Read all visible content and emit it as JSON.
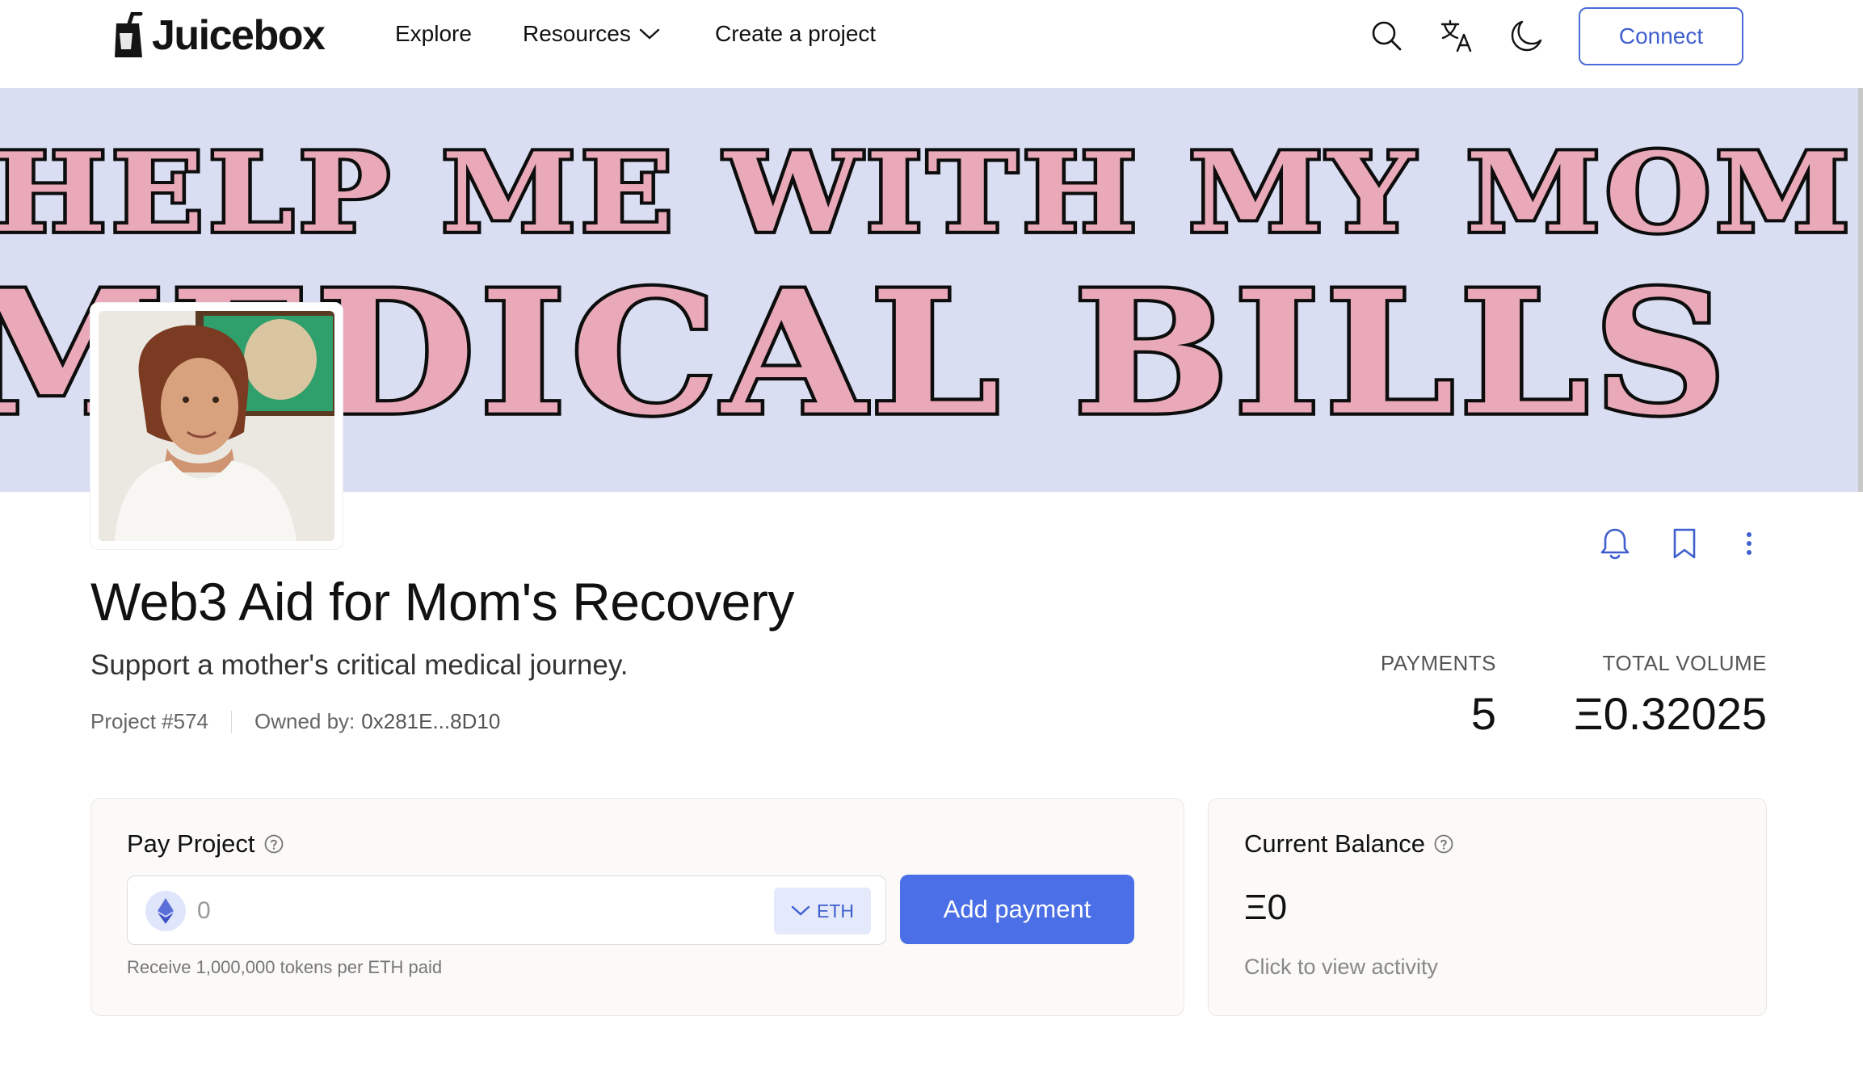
{
  "app": {
    "logo_text": "Juicebox"
  },
  "nav": {
    "explore": "Explore",
    "resources": "Resources",
    "create": "Create a project",
    "connect": "Connect",
    "icons": [
      "search-icon",
      "translate-icon",
      "moon-icon"
    ]
  },
  "banner": {
    "line1": "HELP ME WITH MY MOM'S",
    "line2": "MEDICAL BILLS"
  },
  "project": {
    "title": "Web3 Aid for Mom's Recovery",
    "description": "Support a mother's critical medical journey.",
    "number": "Project #574",
    "owned_by_label": "Owned by:",
    "owner": "0x281E...8D10",
    "action_icons": [
      "bell-icon",
      "bookmark-icon",
      "more-vertical-icon"
    ]
  },
  "stats": {
    "payments_label": "PAYMENTS",
    "payments_value": "5",
    "volume_label": "TOTAL VOLUME",
    "volume_value": "Ξ0.32025"
  },
  "pay": {
    "title": "Pay Project",
    "amount_placeholder": "0",
    "currency": "ETH",
    "button": "Add payment",
    "hint": "Receive 1,000,000 tokens per ETH paid"
  },
  "balance": {
    "title": "Current Balance",
    "value": "Ξ0",
    "link": "Click to view activity"
  },
  "colors": {
    "accent": "#4a6fe6",
    "banner_bg": "#d9def2"
  }
}
